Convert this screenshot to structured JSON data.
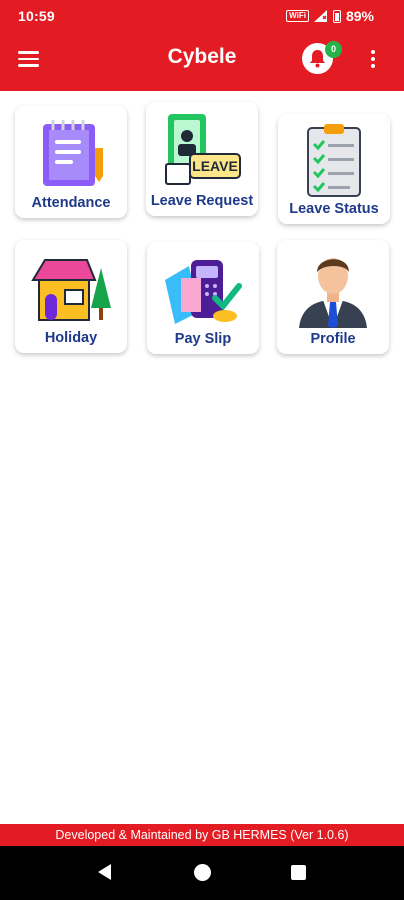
{
  "status_bar": {
    "time": "10:59",
    "wifi_label": "WiFi",
    "battery": "89%"
  },
  "app_bar": {
    "title": "Cybele",
    "notification_count": "0",
    "icons": [
      "menu-icon",
      "bell-icon",
      "more-vert-icon"
    ],
    "color": "#e31b23"
  },
  "tiles": [
    {
      "label": "Attendance",
      "icon": "notepad-icon"
    },
    {
      "label": "Leave Request",
      "icon": "leave-icon"
    },
    {
      "label": "Leave Status",
      "icon": "checklist-icon"
    },
    {
      "label": "Holiday",
      "icon": "house-icon"
    },
    {
      "label": "Pay Slip",
      "icon": "payslip-icon"
    },
    {
      "label": "Profile",
      "icon": "businessman-icon"
    }
  ],
  "footer": {
    "text": "Developed & Maintained by GB HERMES (Ver 1.0.6)"
  },
  "nav_bar": {
    "buttons": [
      "back-icon",
      "home-icon",
      "recents-icon"
    ]
  },
  "colors": {
    "primary": "#e31b23",
    "tile_text": "#1f3a8a",
    "badge": "#26b34a"
  }
}
